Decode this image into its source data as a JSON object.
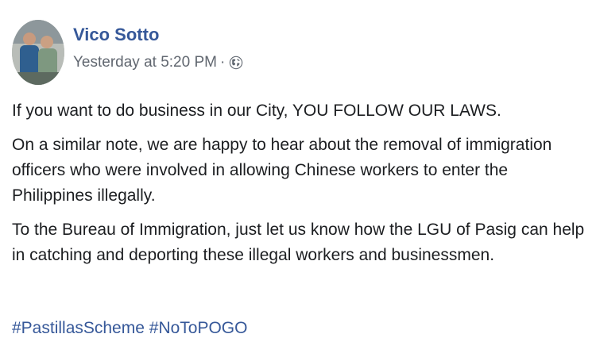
{
  "post": {
    "author": "Vico Sotto",
    "timestamp": "Yesterday at 5:20 PM",
    "separator": "·",
    "privacy_icon": "globe-icon",
    "paragraphs": [
      "If you want to do business in our City, YOU FOLLOW OUR LAWS.",
      "On a similar note, we are happy to hear about the removal of immigration officers who were involved in allowing Chinese workers to enter the Philippines illegally.",
      "To the Bureau of Immigration, just let us know how the LGU of Pasig can help in catching and deporting these illegal workers and businessmen."
    ],
    "hashtags": [
      "#PastillasScheme",
      "#NoToPOGO"
    ]
  },
  "colors": {
    "link": "#365899",
    "meta": "#616770",
    "text": "#1c1e21"
  }
}
